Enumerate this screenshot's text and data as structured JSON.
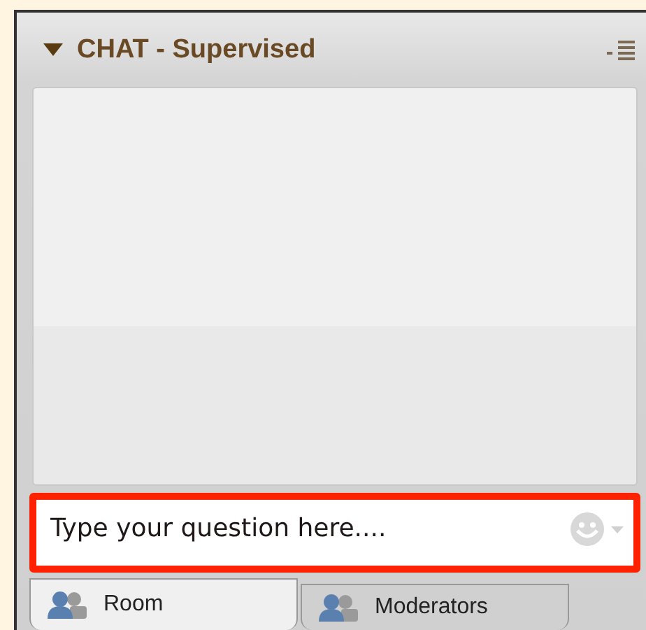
{
  "panel": {
    "title": "CHAT - Supervised",
    "expanded": true
  },
  "input": {
    "placeholder": "Type your question here....",
    "highlighted": true
  },
  "tabs": [
    {
      "label": "Room",
      "selected": true
    },
    {
      "label": "Moderators",
      "selected": false
    }
  ]
}
